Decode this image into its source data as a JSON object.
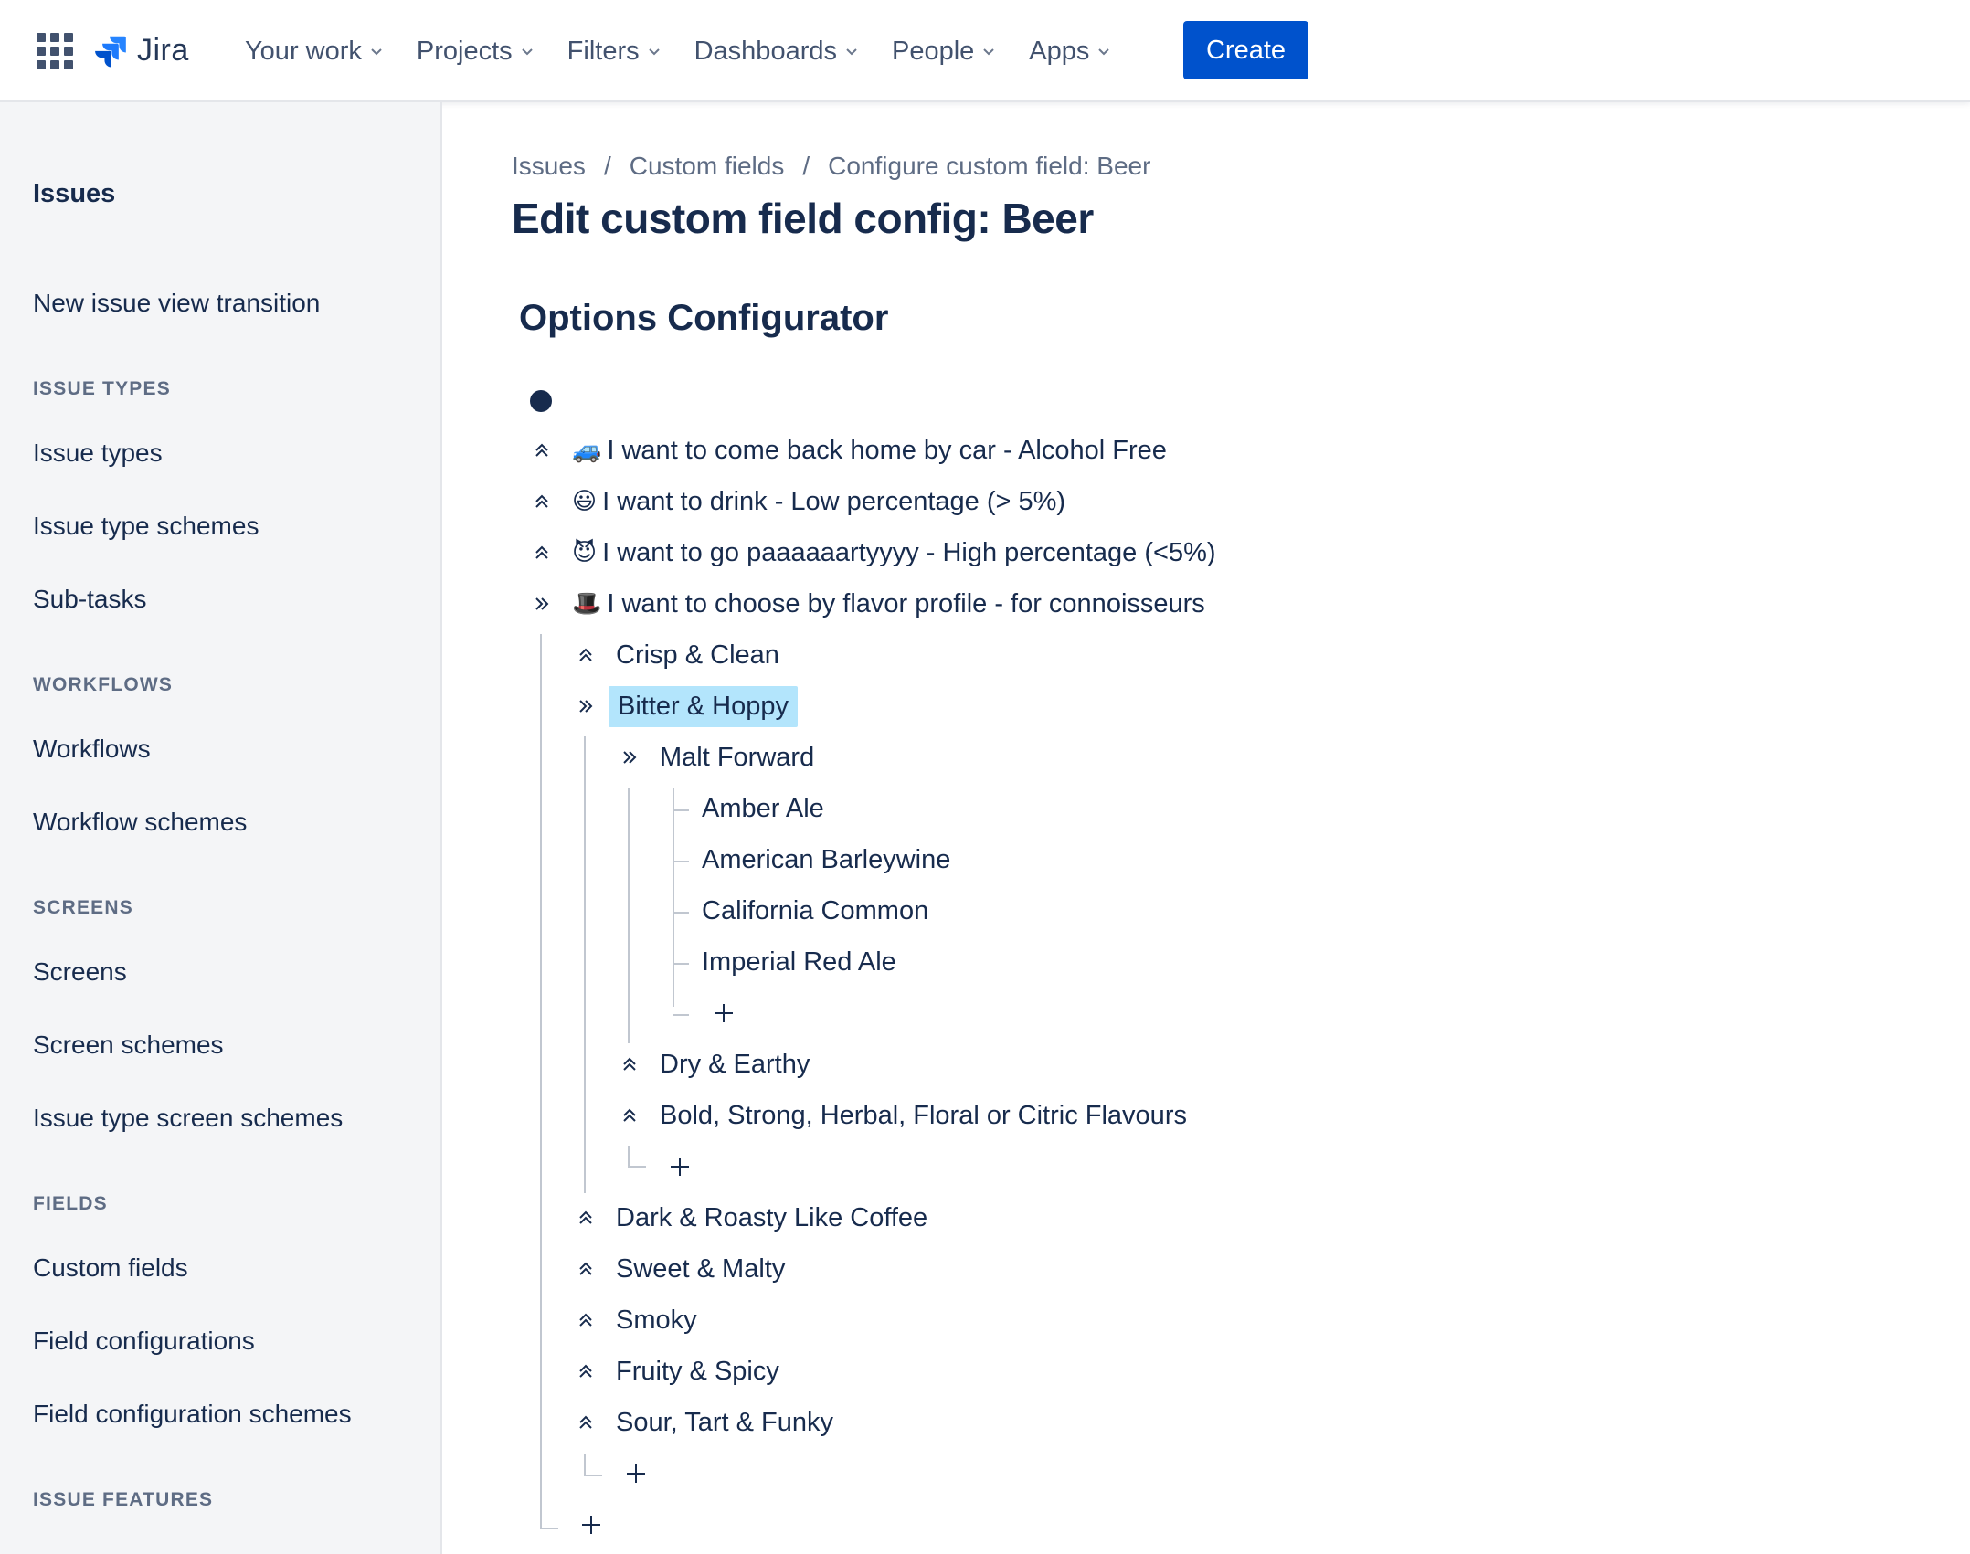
{
  "app": {
    "logo_text": "Jira"
  },
  "nav": {
    "items": [
      "Your work",
      "Projects",
      "Filters",
      "Dashboards",
      "People",
      "Apps"
    ],
    "create_label": "Create"
  },
  "sidebar": {
    "title": "Issues",
    "top_item": "New issue view transition",
    "sections": [
      {
        "heading": "ISSUE TYPES",
        "items": [
          "Issue types",
          "Issue type schemes",
          "Sub-tasks"
        ]
      },
      {
        "heading": "WORKFLOWS",
        "items": [
          "Workflows",
          "Workflow schemes"
        ]
      },
      {
        "heading": "SCREENS",
        "items": [
          "Screens",
          "Screen schemes",
          "Issue type screen schemes"
        ]
      },
      {
        "heading": "FIELDS",
        "items": [
          "Custom fields",
          "Field configurations",
          "Field configuration schemes"
        ]
      },
      {
        "heading": "ISSUE FEATURES",
        "items": []
      }
    ]
  },
  "breadcrumb": {
    "items": [
      "Issues",
      "Custom fields",
      "Configure custom field: Beer"
    ],
    "separator": "/"
  },
  "page_title": "Edit custom field config: Beer",
  "section_title": "Options Configurator",
  "tree": {
    "top_level": [
      {
        "emoji": "🚙",
        "label": "I want to come back home by car - Alcohol Free",
        "expanded": false
      },
      {
        "emoji": "😃",
        "label": "I want to drink - Low percentage (> 5%)",
        "expanded": false
      },
      {
        "emoji": "😈",
        "label": "I want to go paaaaaartyyyy - High percentage (<5%)",
        "expanded": false
      },
      {
        "emoji": "🎩",
        "label": "I want to choose by flavor profile - for connoisseurs",
        "expanded": true
      }
    ],
    "flavor_children": [
      "Crisp & Clean",
      "Bitter & Hoppy",
      "Dark & Roasty Like Coffee",
      "Sweet & Malty",
      "Smoky",
      "Fruity & Spicy",
      "Sour, Tart & Funky"
    ],
    "bitter_children": [
      "Malt Forward",
      "Dry & Earthy",
      "Bold, Strong, Herbal, Floral or Citric Flavours"
    ],
    "malt_children": [
      "Amber Ale",
      "American Barleywine",
      "California Common",
      "Imperial Red Ale"
    ],
    "selected": "Bitter & Hoppy"
  },
  "colors": {
    "primary": "#0052cc",
    "selected_bg": "#b3e5fc",
    "text": "#172b4d",
    "muted": "#5e6c84"
  }
}
